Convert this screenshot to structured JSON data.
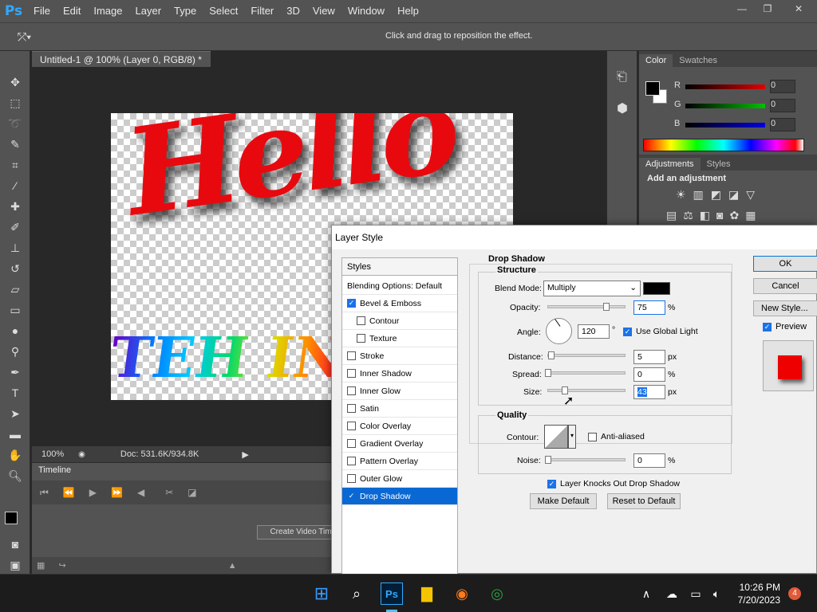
{
  "app": {
    "logo": "Ps"
  },
  "menu": [
    "File",
    "Edit",
    "Image",
    "Layer",
    "Type",
    "Select",
    "Filter",
    "3D",
    "View",
    "Window",
    "Help"
  ],
  "window_controls": {
    "minimize": "—",
    "restore": "❐",
    "close": "✕"
  },
  "options_bar": {
    "hint": "Click and drag to reposition the effect."
  },
  "document": {
    "tab_title": "Untitled-1 @ 100% (Layer 0, RGB/8) *",
    "tab_close": "×",
    "canvas_text_1": "Hello",
    "canvas_text_2": "TEH INT",
    "zoom": "100%",
    "doc_size": "Doc: 531.6K/934.8K"
  },
  "timeline": {
    "tab_label": "Timeline",
    "create_video_label": "Create Video Tim"
  },
  "color_panel": {
    "tabs": [
      "Color",
      "Swatches"
    ],
    "channels": [
      {
        "label": "R",
        "value": "0",
        "color": "#e00000"
      },
      {
        "label": "G",
        "value": "0",
        "color": "#00c000"
      },
      {
        "label": "B",
        "value": "0",
        "color": "#0000e0"
      }
    ]
  },
  "adjustments_panel": {
    "tabs": [
      "Adjustments",
      "Styles"
    ],
    "heading": "Add an adjustment"
  },
  "layer_style": {
    "title": "Layer Style",
    "styles_header": "Styles",
    "items": [
      {
        "label": "Blending Options: Default",
        "checkbox": false,
        "checked": false,
        "sub": false,
        "selected": false
      },
      {
        "label": "Bevel & Emboss",
        "checkbox": true,
        "checked": true,
        "sub": false,
        "selected": false
      },
      {
        "label": "Contour",
        "checkbox": true,
        "checked": false,
        "sub": true,
        "selected": false
      },
      {
        "label": "Texture",
        "checkbox": true,
        "checked": false,
        "sub": true,
        "selected": false
      },
      {
        "label": "Stroke",
        "checkbox": true,
        "checked": false,
        "sub": false,
        "selected": false
      },
      {
        "label": "Inner Shadow",
        "checkbox": true,
        "checked": false,
        "sub": false,
        "selected": false
      },
      {
        "label": "Inner Glow",
        "checkbox": true,
        "checked": false,
        "sub": false,
        "selected": false
      },
      {
        "label": "Satin",
        "checkbox": true,
        "checked": false,
        "sub": false,
        "selected": false
      },
      {
        "label": "Color Overlay",
        "checkbox": true,
        "checked": false,
        "sub": false,
        "selected": false
      },
      {
        "label": "Gradient Overlay",
        "checkbox": true,
        "checked": false,
        "sub": false,
        "selected": false
      },
      {
        "label": "Pattern Overlay",
        "checkbox": true,
        "checked": false,
        "sub": false,
        "selected": false
      },
      {
        "label": "Outer Glow",
        "checkbox": true,
        "checked": false,
        "sub": false,
        "selected": false
      },
      {
        "label": "Drop Shadow",
        "checkbox": true,
        "checked": true,
        "sub": false,
        "selected": true
      }
    ],
    "section_title": "Drop Shadow",
    "structure_label": "Structure",
    "blend_mode_label": "Blend Mode:",
    "blend_mode_value": "Multiply",
    "shadow_color": "#000000",
    "opacity_label": "Opacity:",
    "opacity_value": "75",
    "opacity_fraction": 0.75,
    "unit_percent": "%",
    "unit_px": "px",
    "unit_degree": "°",
    "angle_label": "Angle:",
    "angle_value": "120",
    "use_global_light_label": "Use Global Light",
    "distance_label": "Distance:",
    "distance_value": "5",
    "spread_label": "Spread:",
    "spread_value": "0",
    "size_label": "Size:",
    "size_value": "43",
    "quality_label": "Quality",
    "contour_label": "Contour:",
    "anti_aliased_label": "Anti-aliased",
    "noise_label": "Noise:",
    "noise_value": "0",
    "knocks_out_label": "Layer Knocks Out Drop Shadow",
    "make_default_label": "Make Default",
    "reset_default_label": "Reset to Default",
    "ok_label": "OK",
    "cancel_label": "Cancel",
    "new_style_label": "New Style...",
    "preview_label": "Preview"
  },
  "taskbar": {
    "time": "10:26 PM",
    "date": "7/20/2023",
    "notification_count": "4"
  }
}
